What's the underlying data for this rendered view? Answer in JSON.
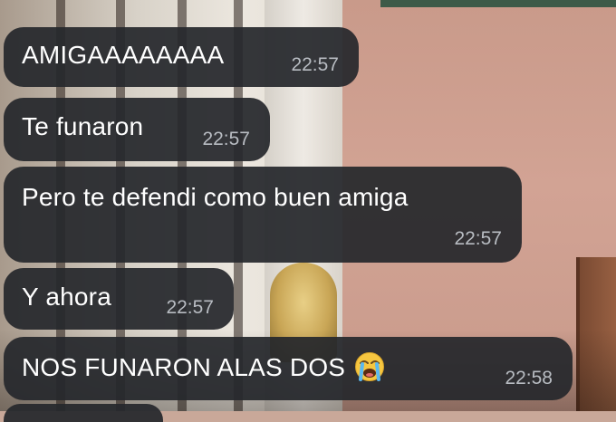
{
  "messages": [
    {
      "text": "AMIGAAAAAAAA",
      "time": "22:57"
    },
    {
      "text": "Te funaron",
      "time": "22:57"
    },
    {
      "text": "Pero te defendi como buen amiga",
      "time": "22:57"
    },
    {
      "text": "Y ahora",
      "time": "22:57"
    },
    {
      "text": "NOS FUNARON ALAS DOS",
      "time": "22:58",
      "emoji": "loudly-crying-face-icon"
    }
  ],
  "colors": {
    "bubble_bg": "#26282c",
    "bubble_text": "#ffffff",
    "timestamp_text": "#b8bcc2"
  }
}
